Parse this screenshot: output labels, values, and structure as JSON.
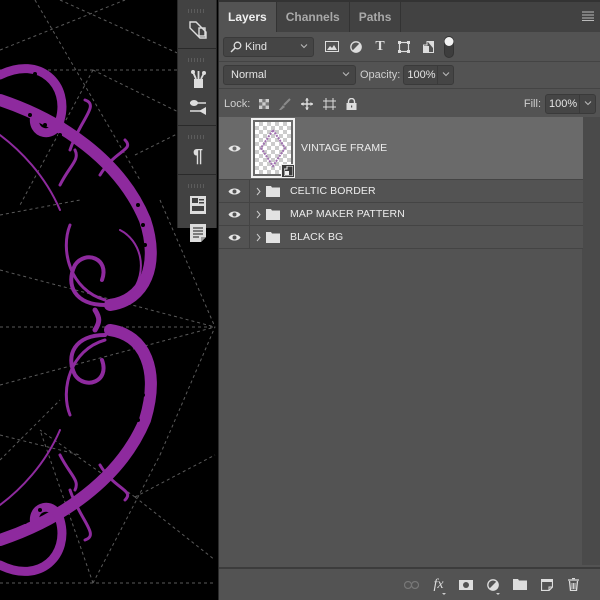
{
  "colors": {
    "panel_bg": "#535353",
    "tabbar_bg": "#424242",
    "selected_row": "#6a6a6a",
    "canvas_bg": "#000000",
    "ornament": "#8e2a9e",
    "guides": "#5a5a5a"
  },
  "panel": {
    "tabs": [
      {
        "label": "Layers",
        "active": true
      },
      {
        "label": "Channels",
        "active": false
      },
      {
        "label": "Paths",
        "active": false
      }
    ],
    "menu_icon": "hamburger-menu-icon"
  },
  "filter": {
    "kind_label": "Kind",
    "icons": [
      "pixel-layer-filter-icon",
      "adjustment-layer-filter-icon",
      "type-layer-filter-icon",
      "shape-layer-filter-icon",
      "smart-object-filter-icon",
      "filter-toggle-icon"
    ]
  },
  "blend": {
    "mode": "Normal",
    "opacity_label": "Opacity:",
    "opacity_value": "100%"
  },
  "lock": {
    "label": "Lock:",
    "icons": [
      "lock-transparent-pixels-icon",
      "lock-image-pixels-icon",
      "lock-position-icon",
      "lock-artboard-icon",
      "lock-all-icon"
    ],
    "fill_label": "Fill:",
    "fill_value": "100%"
  },
  "layers": [
    {
      "name": "VINTAGE FRAME",
      "type": "smart-object",
      "visible": true,
      "selected": true
    },
    {
      "name": "CELTIC BORDER",
      "type": "group",
      "visible": true,
      "selected": false
    },
    {
      "name": "MAP MAKER PATTERN",
      "type": "group",
      "visible": true,
      "selected": false
    },
    {
      "name": "BLACK BG",
      "type": "group",
      "visible": true,
      "selected": false
    }
  ],
  "footer": {
    "icons": [
      "link-layers-icon",
      "fx-icon",
      "add-mask-icon",
      "new-adjustment-layer-icon",
      "new-group-icon",
      "new-layer-icon",
      "delete-layer-icon"
    ]
  },
  "dock": {
    "icons": [
      "transform-panel-icon",
      "brushes-panel-icon",
      "brush-settings-icon",
      "paragraph-panel-icon",
      "properties-panel-icon",
      "notes-panel-icon"
    ]
  }
}
